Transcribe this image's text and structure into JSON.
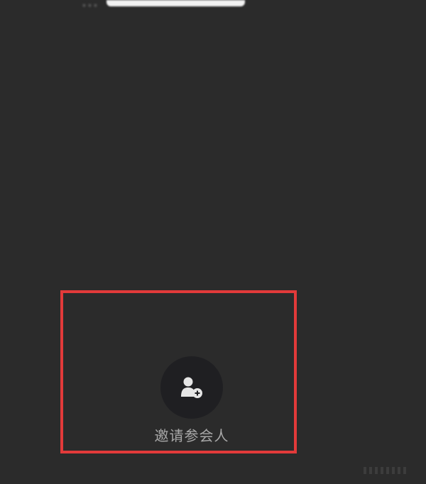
{
  "top_title": "...",
  "invite": {
    "label": "邀请参会人",
    "icon": "add-person-icon"
  },
  "colors": {
    "background": "#2b2b2b",
    "button_background": "#1f1f22",
    "label": "#a8a8a8",
    "highlight_border": "#e23a3a"
  }
}
